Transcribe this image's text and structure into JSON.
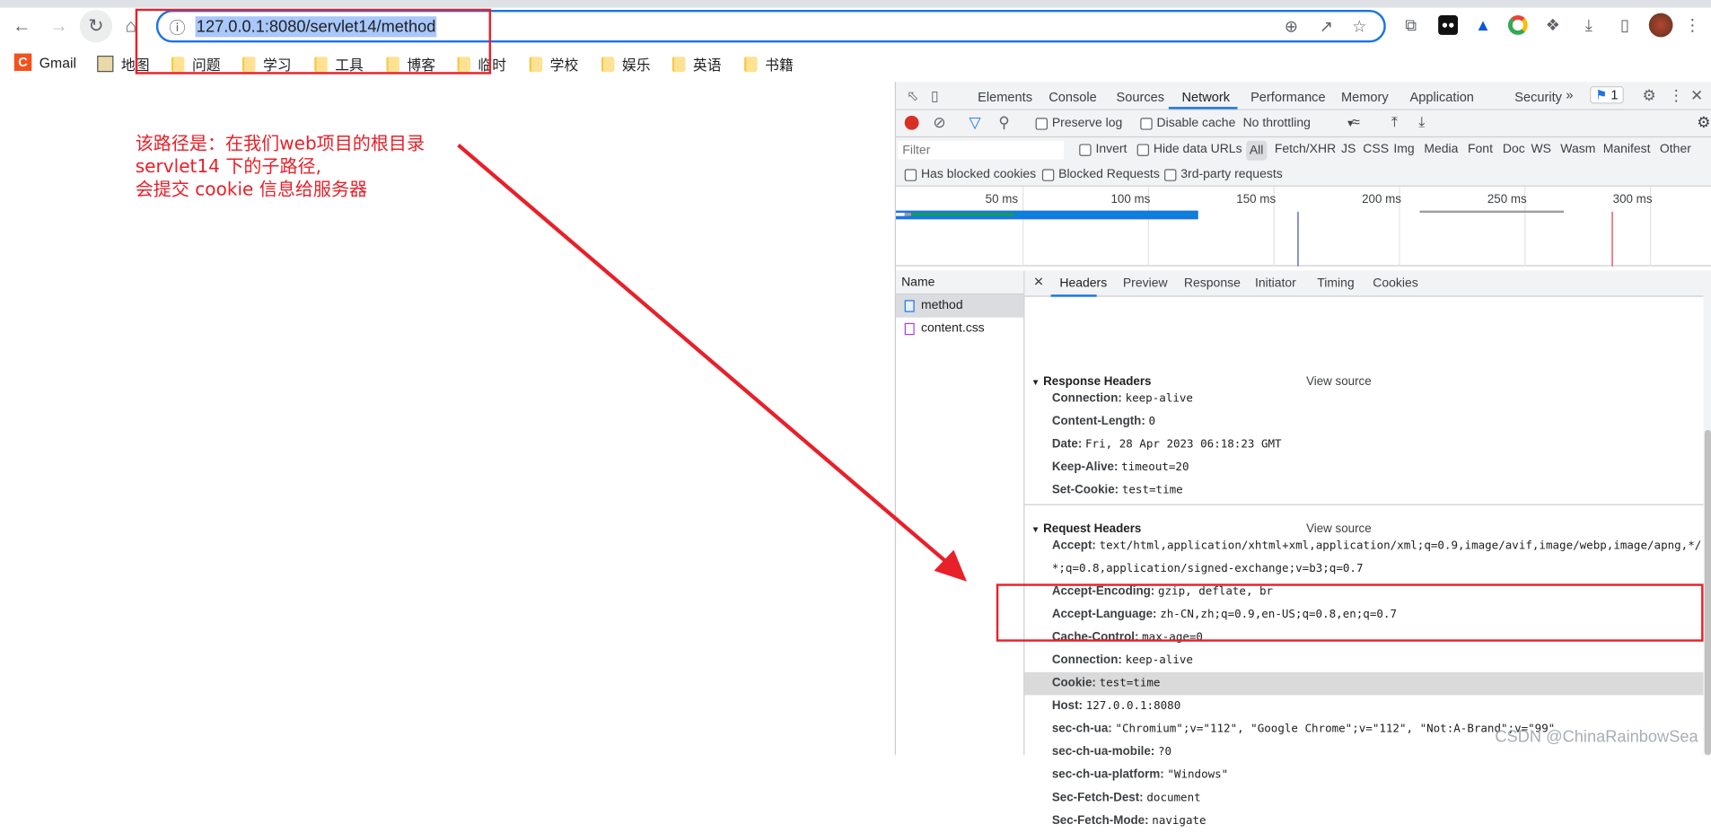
{
  "browser": {
    "url": "127.0.0.1:8080/servlet14/method",
    "icons": [
      "back-icon",
      "forward-icon",
      "reload-icon",
      "home-icon",
      "info-icon",
      "zoom-icon",
      "share-icon",
      "star-icon",
      "tab-search-icon",
      "extension-icons",
      "puzzle-icon",
      "download-icon",
      "sidepanel-icon",
      "avatar",
      "menu-icon"
    ]
  },
  "bookmarks": [
    {
      "label": "Gmail"
    },
    {
      "label": "地图"
    },
    {
      "label": "问题"
    },
    {
      "label": "学习"
    },
    {
      "label": "工具"
    },
    {
      "label": "博客"
    },
    {
      "label": "临时"
    },
    {
      "label": "学校"
    },
    {
      "label": "娱乐"
    },
    {
      "label": "英语"
    },
    {
      "label": "书籍"
    }
  ],
  "annotation": {
    "lines": [
      "该路径是：在我们web项目的根目录",
      "servlet14 下的子路径,",
      "会提交 cookie 信息给服务器"
    ],
    "color": "#e8202a"
  },
  "devtools": {
    "tabs": [
      "Elements",
      "Console",
      "Sources",
      "Network",
      "Performance",
      "Memory",
      "Application",
      "Security"
    ],
    "active_tab": "Network",
    "issues_count": "1",
    "toolbar": {
      "preserve_log": "Preserve log",
      "disable_cache": "Disable cache",
      "throttling": "No throttling"
    },
    "filter": {
      "placeholder": "Filter",
      "invert": "Invert",
      "hide_data_urls": "Hide data URLs",
      "types": [
        "All",
        "Fetch/XHR",
        "JS",
        "CSS",
        "Img",
        "Media",
        "Font",
        "Doc",
        "WS",
        "Wasm",
        "Manifest",
        "Other"
      ],
      "active_type": "All"
    },
    "checks": [
      "Has blocked cookies",
      "Blocked Requests",
      "3rd-party requests"
    ],
    "timeline_ticks": [
      "50 ms",
      "100 ms",
      "150 ms",
      "200 ms",
      "250 ms",
      "300 ms"
    ],
    "name_header": "Name",
    "requests": [
      {
        "name": "method",
        "type": "document"
      },
      {
        "name": "content.css",
        "type": "stylesheet"
      }
    ],
    "detail_tabs": [
      "Headers",
      "Preview",
      "Response",
      "Initiator",
      "Timing",
      "Cookies"
    ],
    "active_detail_tab": "Headers",
    "view_source": "View source",
    "response_headers_title": "Response Headers",
    "response_headers": [
      {
        "k": "Connection:",
        "v": "keep-alive"
      },
      {
        "k": "Content-Length:",
        "v": "0"
      },
      {
        "k": "Date:",
        "v": "Fri, 28 Apr 2023 06:18:23 GMT"
      },
      {
        "k": "Keep-Alive:",
        "v": "timeout=20"
      },
      {
        "k": "Set-Cookie:",
        "v": "test=time"
      }
    ],
    "request_headers_title": "Request Headers",
    "request_headers": [
      {
        "k": "Accept:",
        "v": "text/html,application/xhtml+xml,application/xml;q=0.9,image/avif,image/webp,image/apng,*/",
        "v2": "*;q=0.8,application/signed-exchange;v=b3;q=0.7"
      },
      {
        "k": "Accept-Encoding:",
        "v": "gzip, deflate, br"
      },
      {
        "k": "Accept-Language:",
        "v": "zh-CN,zh;q=0.9,en-US;q=0.8,en;q=0.7"
      },
      {
        "k": "Cache-Control:",
        "v": "max-age=0"
      },
      {
        "k": "Connection:",
        "v": "keep-alive"
      },
      {
        "k": "Cookie:",
        "v": "test=time",
        "highlighted": true
      },
      {
        "k": "Host:",
        "v": "127.0.0.1:8080"
      },
      {
        "k": "sec-ch-ua:",
        "v": "\"Chromium\";v=\"112\", \"Google Chrome\";v=\"112\", \"Not:A-Brand\";v=\"99\""
      },
      {
        "k": "sec-ch-ua-mobile:",
        "v": "?0"
      },
      {
        "k": "sec-ch-ua-platform:",
        "v": "\"Windows\""
      },
      {
        "k": "Sec-Fetch-Dest:",
        "v": "document"
      },
      {
        "k": "Sec-Fetch-Mode:",
        "v": "navigate"
      }
    ]
  },
  "watermark": "CSDN @ChinaRainbowSea"
}
